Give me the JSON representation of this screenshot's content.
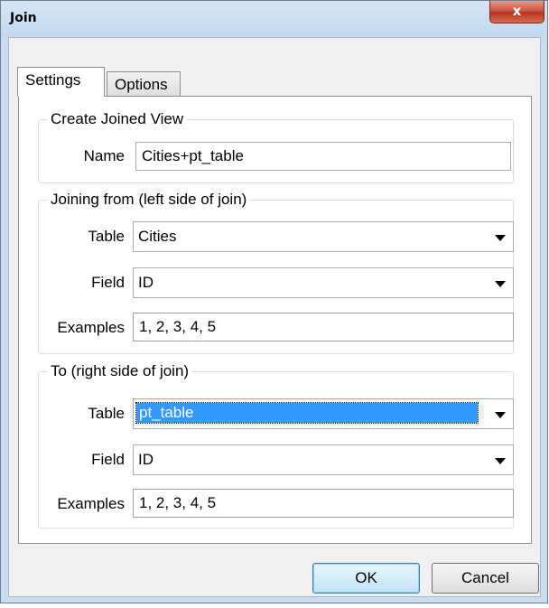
{
  "window": {
    "title": "Join",
    "close_label": "x"
  },
  "tabs": [
    {
      "label": "Settings",
      "active": true
    },
    {
      "label": "Options",
      "active": false
    }
  ],
  "create_joined_view": {
    "legend": "Create Joined View",
    "name_label": "Name",
    "name_value": "Cities+pt_table"
  },
  "joining_from": {
    "legend": "Joining from (left side of join)",
    "table_label": "Table",
    "table_value": "Cities",
    "field_label": "Field",
    "field_value": "ID",
    "examples_label": "Examples",
    "examples_value": "1, 2, 3, 4, 5"
  },
  "joining_to": {
    "legend": "To (right side of join)",
    "table_label": "Table",
    "table_value": "pt_table",
    "field_label": "Field",
    "field_value": "ID",
    "examples_label": "Examples",
    "examples_value": "1, 2, 3, 4, 5"
  },
  "buttons": {
    "ok": "OK",
    "cancel": "Cancel"
  },
  "icons": {
    "close": "close-icon",
    "dropdown": "chevron-down-icon"
  },
  "colors": {
    "selection": "#3399ff",
    "close_button": "#c9503d",
    "frame": "#c9dcf0"
  }
}
